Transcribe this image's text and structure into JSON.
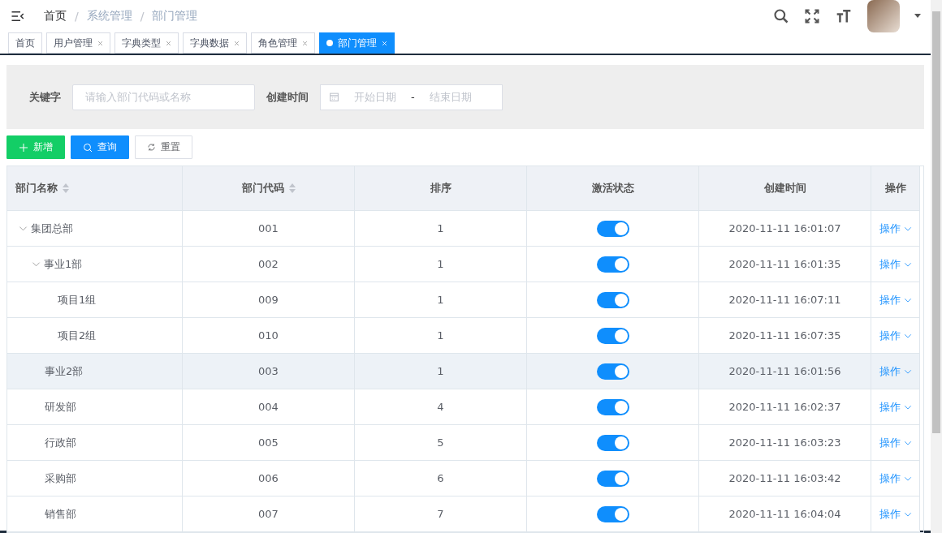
{
  "breadcrumb": [
    {
      "kind": "link",
      "label": "首页"
    },
    {
      "kind": "separator",
      "label": "/"
    },
    {
      "kind": "current",
      "label": "系统管理"
    },
    {
      "kind": "separator",
      "label": "/"
    },
    {
      "kind": "current",
      "label": "部门管理"
    }
  ],
  "tabs": [
    {
      "label": "首页",
      "selected": false,
      "closable": false
    },
    {
      "label": "用户管理",
      "selected": false,
      "closable": true
    },
    {
      "label": "字典类型",
      "selected": false,
      "closable": true
    },
    {
      "label": "字典数据",
      "selected": false,
      "closable": true
    },
    {
      "label": "角色管理",
      "selected": false,
      "closable": true
    },
    {
      "label": "部门管理",
      "selected": true,
      "closable": true
    }
  ],
  "filters": {
    "keyword_label": "关键字",
    "keyword_placeholder": "请输入部门代码或名称",
    "date_label": "创建时间",
    "start_placeholder": "开始日期",
    "separator": "-",
    "end_placeholder": "结束日期"
  },
  "buttons": [
    {
      "kind": "add",
      "label": "新增"
    },
    {
      "kind": "search",
      "label": "查询"
    },
    {
      "kind": "reset",
      "label": "重置"
    }
  ],
  "table": {
    "columns": [
      {
        "label": "部门名称",
        "sortable": true
      },
      {
        "label": "部门代码",
        "sortable": true
      },
      {
        "label": "排序",
        "sortable": false
      },
      {
        "label": "激活状态",
        "sortable": false
      },
      {
        "label": "创建时间",
        "sortable": false
      },
      {
        "label": "操作",
        "sortable": false
      }
    ],
    "rows": [
      {
        "name": "集团总部",
        "code": "001",
        "order": "1",
        "on": true,
        "created": "2020-11-11 16:01:07",
        "action": "操作",
        "selected": false,
        "expanded": true,
        "children": [
          {
            "name": "事业1部",
            "code": "002",
            "order": "1",
            "on": true,
            "created": "2020-11-11 16:01:35",
            "action": "操作",
            "selected": false,
            "expanded": true,
            "children": [
              {
                "name": "项目1组",
                "code": "009",
                "order": "1",
                "on": true,
                "created": "2020-11-11 16:07:11",
                "action": "操作",
                "selected": false
              },
              {
                "name": "项目2组",
                "code": "010",
                "order": "1",
                "on": true,
                "created": "2020-11-11 16:07:35",
                "action": "操作",
                "selected": false
              }
            ]
          },
          {
            "name": "事业2部",
            "code": "003",
            "order": "1",
            "on": true,
            "created": "2020-11-11 16:01:56",
            "action": "操作",
            "selected": true
          },
          {
            "name": "研发部",
            "code": "004",
            "order": "4",
            "on": true,
            "created": "2020-11-11 16:02:37",
            "action": "操作",
            "selected": false
          },
          {
            "name": "行政部",
            "code": "005",
            "order": "5",
            "on": true,
            "created": "2020-11-11 16:03:23",
            "action": "操作",
            "selected": false
          },
          {
            "name": "采购部",
            "code": "006",
            "order": "6",
            "on": true,
            "created": "2020-11-11 16:03:42",
            "action": "操作",
            "selected": false
          },
          {
            "name": "销售部",
            "code": "007",
            "order": "7",
            "on": true,
            "created": "2020-11-11 16:04:04",
            "action": "操作",
            "selected": false
          }
        ]
      }
    ]
  }
}
